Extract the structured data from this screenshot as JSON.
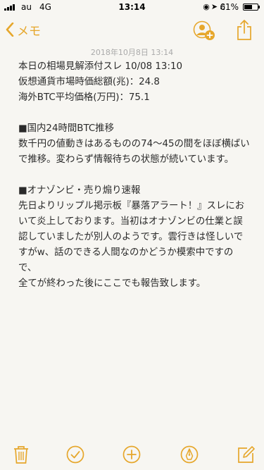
{
  "status_bar": {
    "carrier": "au",
    "network": "4G",
    "time": "13:14",
    "battery_percent": "61%",
    "battery_level": 0.61
  },
  "nav": {
    "back_label": "メモ",
    "accent_color": "#e6a72c"
  },
  "note": {
    "date": "2018年10月8日 13:14",
    "lines": [
      "本日の相場見解添付スレ 10/08 13:10",
      "仮想通貨市場時価総額(兆)：24.8",
      "海外BTC平均価格(万円)：75.1",
      "",
      "■国内24時間BTC推移",
      "数千円の値動きはあるものの74〜45の間をほぼ横ばい",
      "で推移。変わらず情報待ちの状態が続いています。",
      "",
      "■オナゾンビ・売り煽り速報",
      "先日よりリップル掲示板『暴落アラート！』スレにお",
      "いて炎上しております。当初はオナゾンビの仕業と誤",
      "認していましたが別人のようです。雲行きは怪しいで",
      "すがw、話のできる人間なのかどうか模索中ですので、",
      "全てが終わった後にここでも報告致します。"
    ]
  },
  "toolbar": {
    "icons": [
      "trash-icon",
      "checklist-icon",
      "add-icon",
      "markup-icon",
      "compose-icon"
    ]
  }
}
